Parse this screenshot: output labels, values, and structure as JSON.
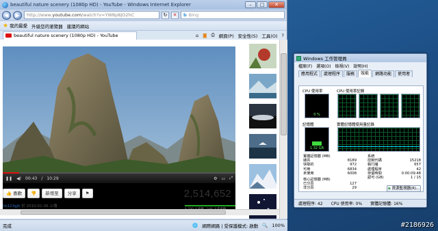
{
  "ie": {
    "title": "beautiful nature scenery (1080p HD) - YouTube - Windows Internet Explorer",
    "url_prefix": "http://www.",
    "url_domain": "youtube.com",
    "url_rest": "/watch?v=YW8p8JO2hC",
    "search_placeholder": "Bing",
    "fav_label": "我的最愛",
    "fav_item1": "升級您的瀏覽器",
    "fav_item2": "建議的網站",
    "tab_title": "beautiful nature scenery (1080p HD) - YouTube",
    "cmd_page": "網頁(P)",
    "cmd_safety": "安全性(S)",
    "cmd_tools": "工具(O)",
    "status_left": "完成",
    "status_zone": "網際網路 | 受保護模式: 啟動",
    "zoom": "100%"
  },
  "youtube": {
    "time_current": "00:43",
    "time_total": "10:29",
    "progress_pct": 7,
    "btn_like": "喜歡",
    "btn_add": "新增至",
    "btn_share": "分享",
    "views": "2,514,652",
    "uploader": "hk123gjh",
    "upload_date": "於 2010-01-06 上傳",
    "likes_text": "4,700 人喜歡，166 人不喜歡"
  },
  "taskmgr": {
    "title": "Windows 工作管理員",
    "menu": [
      "檔案(F)",
      "選項(O)",
      "檢視(V)",
      "說明(H)"
    ],
    "tabs": [
      "應用程式",
      "處理程序",
      "服務",
      "效能",
      "網路功能",
      "使用者"
    ],
    "active_tab": 3,
    "cpu_usage_label": "CPU 使用率",
    "cpu_history_label": "CPU 使用率記錄",
    "cpu_value": "0 %",
    "mem_label": "記憶體",
    "mem_history_label": "實體記憶體使用量記錄",
    "mem_value": "1.32 GB",
    "phys_header": "實體記憶體 (MB)",
    "phys_rows": [
      [
        "總共",
        "8189"
      ],
      [
        "快取的",
        "972"
      ],
      [
        "可用",
        "6834"
      ],
      [
        "未使用",
        "6008"
      ]
    ],
    "system_header": "系統",
    "system_rows": [
      [
        "控制代碼",
        "15218"
      ],
      [
        "執行緒",
        "657"
      ],
      [
        "處理程序",
        "42"
      ],
      [
        "存留時間",
        "0:00:09:48"
      ],
      [
        "認可 (GB)",
        "1 / 15"
      ]
    ],
    "kernel_header": "核心記憶體 (MB)",
    "kernel_rows": [
      [
        "已分頁",
        "127"
      ],
      [
        "非分頁",
        "29"
      ]
    ],
    "resmon_button": "資源監視器(R)...",
    "status_processes": "處理程序: 42",
    "status_cpu": "CPU 使用率: 0%",
    "status_mem": "實體記憶體: 16%"
  },
  "watermark": "#2186926"
}
